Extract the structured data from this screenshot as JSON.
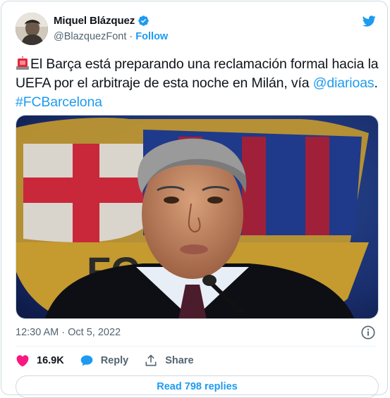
{
  "author": {
    "name": "Miquel Blázquez",
    "handle": "@BlazquezFont",
    "separator": "·",
    "follow_label": "Follow"
  },
  "tweet": {
    "text_main": "El Barça está preparando una reclamación formal hacia la UEFA por el arbitraje de esta noche en Milán, vía ",
    "mention": "@diarioas",
    "after_mention": ". ",
    "hashtag": "#FCBarcelona",
    "emoji": "police-car-light"
  },
  "media": {
    "crest_letters": "FC"
  },
  "meta": {
    "timestamp": "12:30 AM · Oct 5, 2022"
  },
  "actions": {
    "likes_count": "16.9K",
    "reply_label": "Reply",
    "share_label": "Share"
  },
  "footer": {
    "read_replies": "Read 798 replies"
  },
  "colors": {
    "accent": "#1d9bf0",
    "like": "#f91880",
    "muted": "#536471"
  }
}
